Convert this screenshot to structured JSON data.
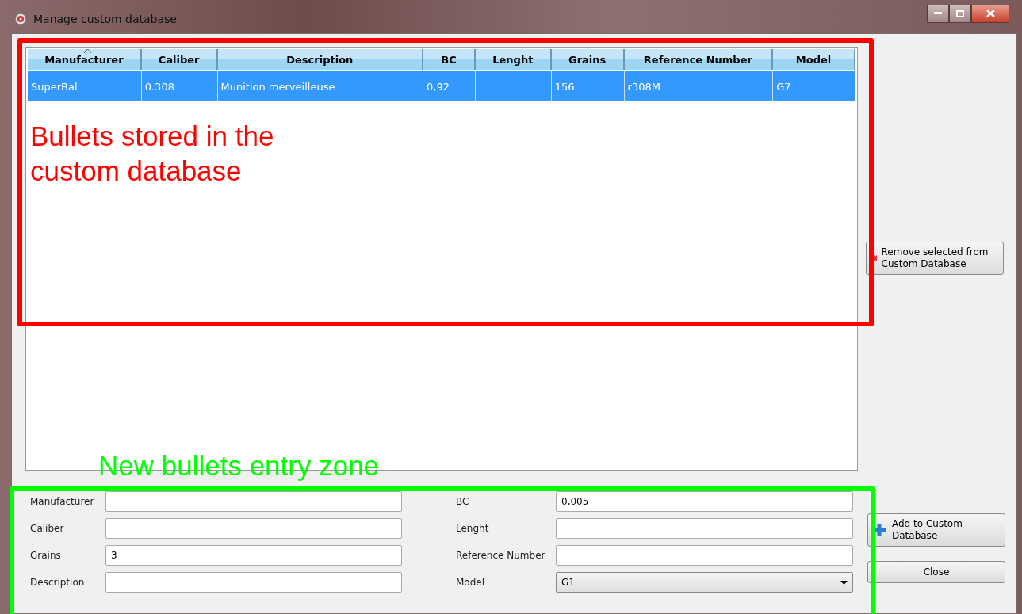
{
  "window": {
    "title": "Manage custom database"
  },
  "table": {
    "columns": [
      {
        "label": "Manufacturer",
        "sorted": true
      },
      {
        "label": "Caliber",
        "sorted": false
      },
      {
        "label": "Description",
        "sorted": false
      },
      {
        "label": "BC",
        "sorted": false
      },
      {
        "label": "Lenght",
        "sorted": false
      },
      {
        "label": "Grains",
        "sorted": false
      },
      {
        "label": "Reference Number",
        "sorted": false
      },
      {
        "label": "Model",
        "sorted": false
      }
    ],
    "rows": [
      {
        "selected": true,
        "cells": [
          "SuperBal",
          "0.308",
          "Munition merveilleuse",
          "0,92",
          null,
          "156",
          "r308M",
          "G7"
        ]
      }
    ]
  },
  "buttons": {
    "remove": "Remove selected from Custom Database",
    "add": "Add to Custom Database",
    "close": "Close"
  },
  "form": {
    "left": [
      {
        "label": "Manufacturer",
        "kind": "text"
      },
      {
        "label": "Caliber",
        "kind": "text"
      },
      {
        "label": "Grains",
        "kind": "text",
        "value": "3"
      },
      {
        "label": "Description",
        "kind": "text"
      }
    ],
    "right": [
      {
        "label": "BC",
        "kind": "text",
        "value": "0,005"
      },
      {
        "label": "Lenght",
        "kind": "text"
      },
      {
        "label": "Reference Number",
        "kind": "text"
      },
      {
        "label": "Model",
        "kind": "select",
        "value": "G1"
      }
    ]
  },
  "annotations": [
    {
      "text": "Bullets stored in the custom database",
      "color": "#ff0000"
    },
    {
      "text": "New bullets entry zone",
      "color": "#00ff00"
    }
  ]
}
